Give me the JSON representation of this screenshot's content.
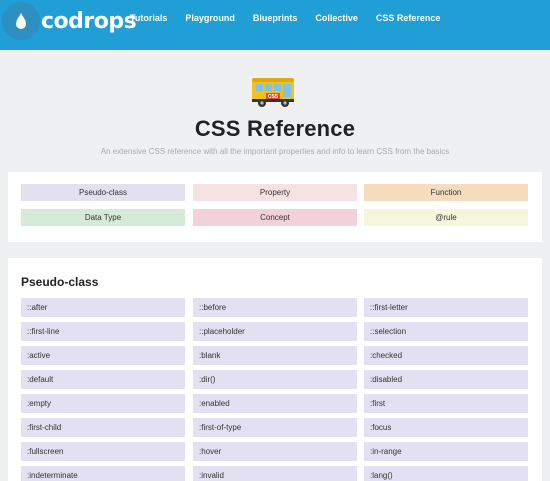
{
  "header": {
    "logo_text": "codrops",
    "nav": [
      "Tutorials",
      "Playground",
      "Blueprints",
      "Collective",
      "CSS Reference"
    ]
  },
  "hero": {
    "badge_text": "CSS",
    "title": "CSS Reference",
    "subtitle": "An extensive CSS reference with all the important properties and info to learn CSS from the basics"
  },
  "legend": [
    "Pseudo-class",
    "Property",
    "Function",
    "Data Type",
    "Concept",
    "@rule"
  ],
  "colors": {
    "header": "#1f9fd6",
    "pseudo_class": "#e3e0f1",
    "property": "#f6e2e3",
    "function": "#f4dcbc",
    "data_type": "#d5ebd7",
    "concept": "#f3d1da",
    "rule": "#f6f6dc"
  },
  "section": {
    "title": "Pseudo-class",
    "items": [
      "::after",
      "::before",
      "::first-letter",
      "::first-line",
      "::placeholder",
      "::selection",
      ":active",
      ":blank",
      ":checked",
      ":default",
      ":dir()",
      ":disabled",
      ":empty",
      ":enabled",
      ":first",
      ":first-child",
      ":first-of-type",
      ":focus",
      ":fullscreen",
      ":hover",
      ":in-range",
      ":indeterminate",
      ":invalid",
      ":lang()"
    ]
  }
}
